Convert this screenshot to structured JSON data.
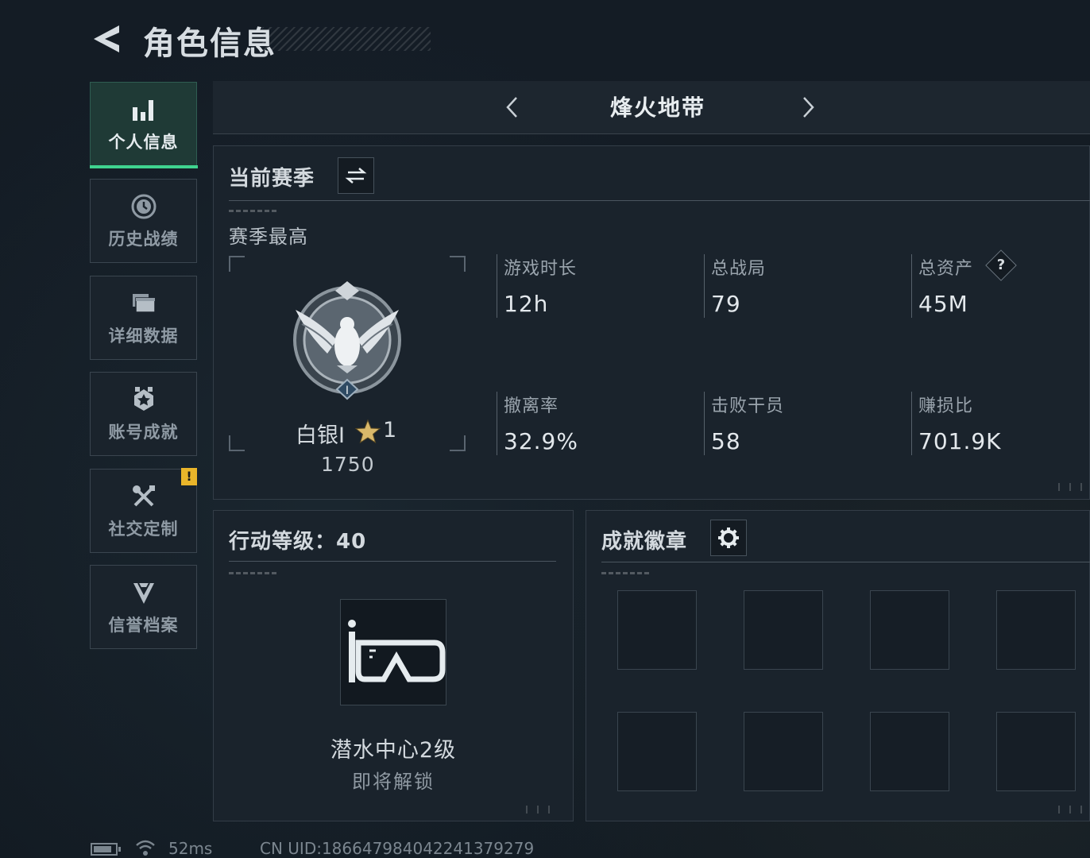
{
  "header": {
    "title": "角色信息"
  },
  "sidebar": {
    "items": [
      {
        "label": "个人信息",
        "icon": "bar-chart-icon",
        "active": true
      },
      {
        "label": "历史战绩",
        "icon": "clock-history-icon",
        "active": false
      },
      {
        "label": "详细数据",
        "icon": "folder-stack-icon",
        "active": false
      },
      {
        "label": "账号成就",
        "icon": "achievement-emblem-icon",
        "active": false
      },
      {
        "label": "社交定制",
        "icon": "tools-icon",
        "active": false,
        "badge": "!"
      },
      {
        "label": "信誉档案",
        "icon": "reputation-shield-icon",
        "active": false
      }
    ]
  },
  "mode": {
    "title": "烽火地带"
  },
  "season": {
    "title": "当前赛季",
    "best_label": "赛季最高",
    "rank_name": "白银I",
    "rank_stars": "1",
    "rank_score": "1750",
    "stats": [
      {
        "label": "游戏时长",
        "value": "12h"
      },
      {
        "label": "总战局",
        "value": "79"
      },
      {
        "label": "总资产",
        "value": "45M",
        "help": "?"
      },
      {
        "label": "撤离率",
        "value": "32.9%"
      },
      {
        "label": "击败干员",
        "value": "58"
      },
      {
        "label": "赚损比",
        "value": "701.9K"
      }
    ]
  },
  "action_level": {
    "title": "行动等级：40",
    "unlock_name": "潜水中心2级",
    "unlock_status": "即将解锁"
  },
  "achievements": {
    "title": "成就徽章",
    "slot_count": 8
  },
  "status_bar": {
    "ping": "52ms",
    "uid": "CN UID:18664798404224137927​9"
  },
  "colors": {
    "accent": "#3fd38f",
    "badge": "#e9b52a",
    "panel": "#1a232c"
  }
}
